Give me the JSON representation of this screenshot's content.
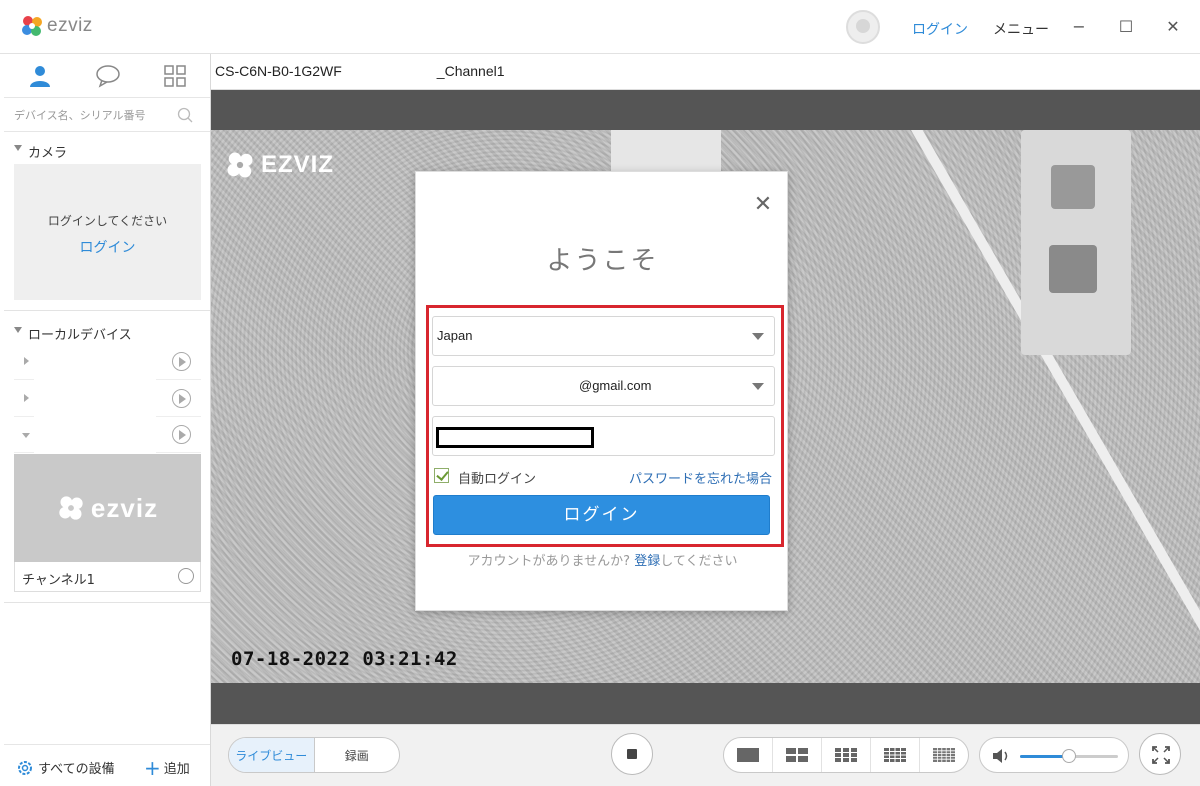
{
  "app": {
    "logo_text": "ezviz",
    "login_link": "ログイン",
    "menu_label": "メニュー",
    "window_buttons": {
      "minimize": "−",
      "maximize": "☐",
      "close": "✕"
    },
    "accent_color": "#2f8bd8"
  },
  "sidebar": {
    "tabs": [
      {
        "icon": "user-icon",
        "active": true
      },
      {
        "icon": "chat-icon",
        "active": false
      },
      {
        "icon": "grid-icon",
        "active": false
      }
    ],
    "search_placeholder": "デバイス名、シリアル番号",
    "camera_section": {
      "header": "カメラ",
      "message": "ログインしてください",
      "login_link": "ログイン"
    },
    "local_section": {
      "header": "ローカルデバイス"
    },
    "thumbnail": {
      "logo_text": "ezviz",
      "caption": "チャンネル1"
    },
    "bottom": {
      "all_devices": "すべての設備",
      "add": "追加"
    }
  },
  "main": {
    "tab_title_prefix": "CS-C6N-B0-1G2WF",
    "tab_title_suffix": "_Channel1",
    "video": {
      "overlay_logo": "EZVIZ",
      "timestamp": "07-18-2022 03:21:42"
    }
  },
  "login_modal": {
    "title": "ようこそ",
    "close_icon": "close-icon",
    "region_value": "Japan",
    "email_suffix": "@gmail.com",
    "auto_login_label": "自動ログイン",
    "auto_login_checked": true,
    "forgot_password": "パスワードを忘れた場合",
    "login_button": "ログイン",
    "no_account_text": "アカウントがありませんか?",
    "register_link": "登録",
    "register_suffix": "してください",
    "highlight_color": "#d8262e"
  },
  "control_bar": {
    "live_view": "ライブビュー",
    "recording": "録画",
    "volume_level": 0.5
  }
}
